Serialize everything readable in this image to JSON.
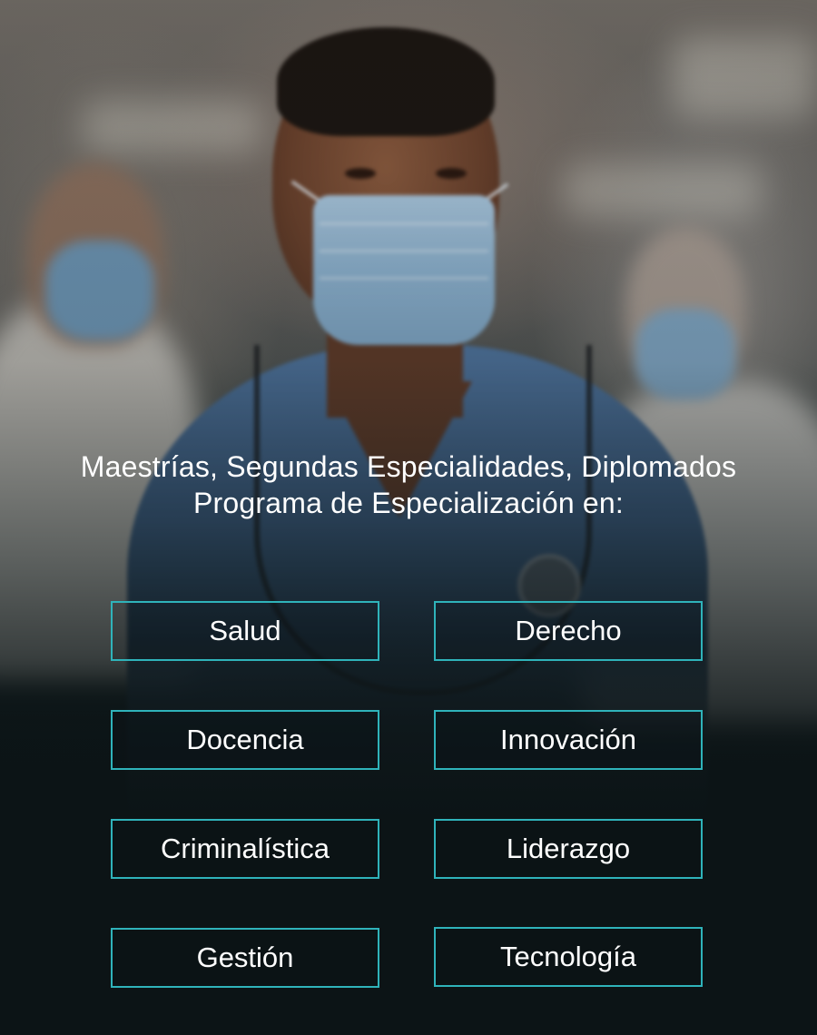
{
  "hero": {
    "image_alt": "healthcare-professional-photo"
  },
  "headline": {
    "line1": "Maestrías, Segundas Especialidades, Diplomados",
    "line2": "Programa de Especialización en:"
  },
  "categories": [
    "Salud",
    "Derecho",
    "Docencia",
    "Innovación",
    "Criminalística",
    "Liderazgo",
    "Gestión",
    "Tecnología"
  ],
  "colors": {
    "accent_border": "#2fb3ba",
    "background_dark": "#0c1416",
    "text": "#ffffff"
  }
}
